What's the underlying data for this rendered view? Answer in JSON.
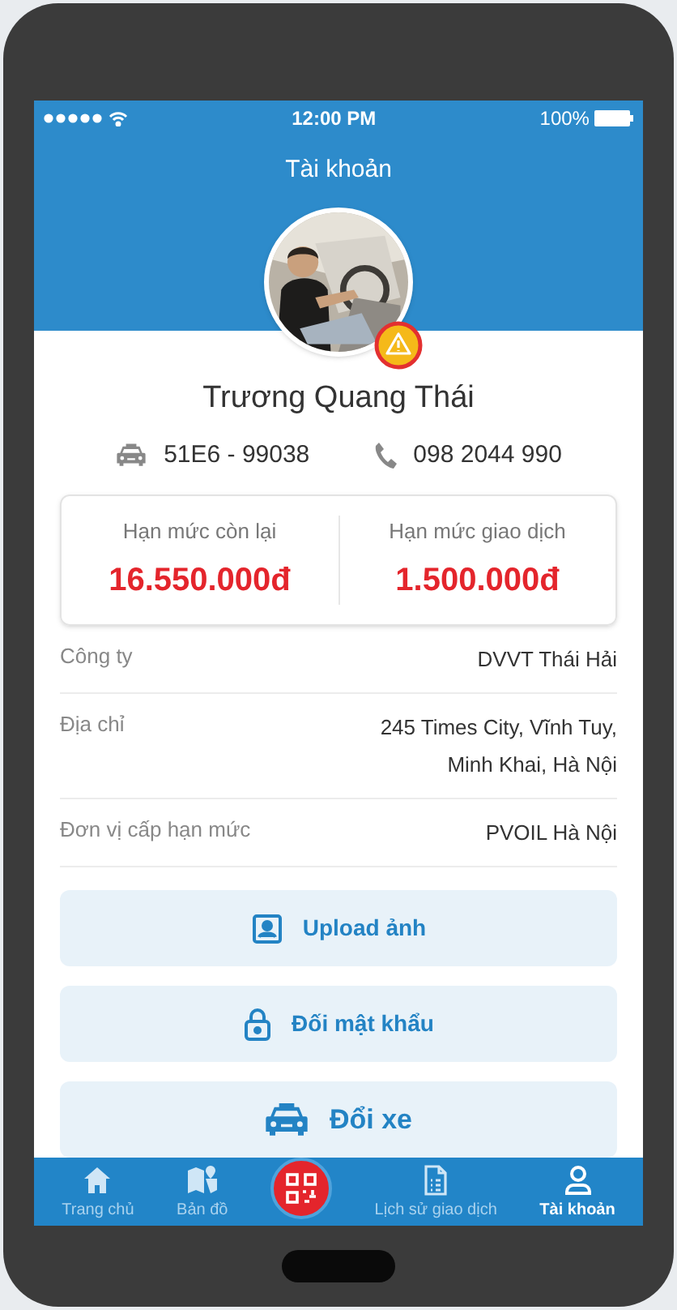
{
  "status_bar": {
    "time": "12:00 PM",
    "battery": "100%"
  },
  "header": {
    "title": "Tài khoản"
  },
  "profile": {
    "warning": true,
    "name": "Trương Quang Thái",
    "plate": "51E6 - 99038",
    "phone": "098 2044 990"
  },
  "limits": [
    {
      "label": "Hạn mức còn lại",
      "value": "16.550.000đ"
    },
    {
      "label": "Hạn mức giao dịch",
      "value": "1.500.000đ"
    }
  ],
  "details": [
    {
      "label": "Công ty",
      "value": "DVVT Thái Hải"
    },
    {
      "label": "Địa chỉ",
      "value": "245 Times City, Vĩnh Tuy, Minh Khai, Hà Nội"
    },
    {
      "label": "Đơn vị cấp hạn mức",
      "value": "PVOIL Hà Nội"
    }
  ],
  "actions": [
    {
      "kind": "upload",
      "label": "Upload ảnh"
    },
    {
      "kind": "password",
      "label": "Đối mật khẩu"
    },
    {
      "kind": "car",
      "label": "Đổi xe"
    }
  ],
  "tab_bar": [
    {
      "kind": "home",
      "label": "Trang chủ",
      "selected": false
    },
    {
      "kind": "map",
      "label": "Bản đồ",
      "selected": false
    },
    {
      "kind": "qr",
      "selected": false
    },
    {
      "kind": "history",
      "label": "Lịch sử giao dịch",
      "selected": false
    },
    {
      "kind": "account",
      "label": "Tài khoản",
      "selected": true
    }
  ]
}
